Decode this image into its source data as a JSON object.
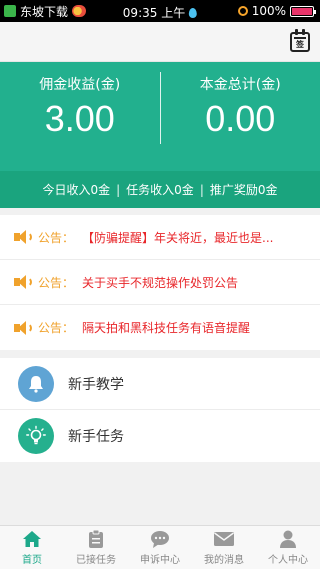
{
  "status_bar": {
    "carrier": "东坡下载",
    "time": "09:35 上午",
    "battery": "100%"
  },
  "header": {
    "calendar_label": "签"
  },
  "summary": {
    "commission_label": "佣金收益(金)",
    "commission_value": "3.00",
    "principal_label": "本金总计(金)",
    "principal_value": "0.00",
    "today_income": "今日收入0金",
    "task_income": "任务收入0金",
    "referral_reward": "推广奖励0金",
    "separator": "|"
  },
  "notices": [
    {
      "prefix": "公告：",
      "text": "【防骗提醒】年关将近，最近也是..."
    },
    {
      "prefix": "公告：",
      "text": "关于买手不规范操作处罚公告"
    },
    {
      "prefix": "公告：",
      "text": "隔天拍和黑科技任务有语音提醒"
    }
  ],
  "menu": [
    {
      "label": "新手教学",
      "icon": "bell-icon"
    },
    {
      "label": "新手任务",
      "icon": "lightbulb-icon"
    }
  ],
  "tabbar": [
    {
      "label": "首页",
      "icon": "home-icon",
      "active": true
    },
    {
      "label": "已接任务",
      "icon": "clipboard-icon",
      "active": false
    },
    {
      "label": "申诉中心",
      "icon": "chat-icon",
      "active": false
    },
    {
      "label": "我的消息",
      "icon": "mail-icon",
      "active": false
    },
    {
      "label": "个人中心",
      "icon": "person-icon",
      "active": false
    }
  ],
  "colors": {
    "primary": "#22b08e",
    "notice_prefix": "#f0a22c",
    "notice_text": "#e8262a",
    "tab_active": "#1da88a"
  }
}
